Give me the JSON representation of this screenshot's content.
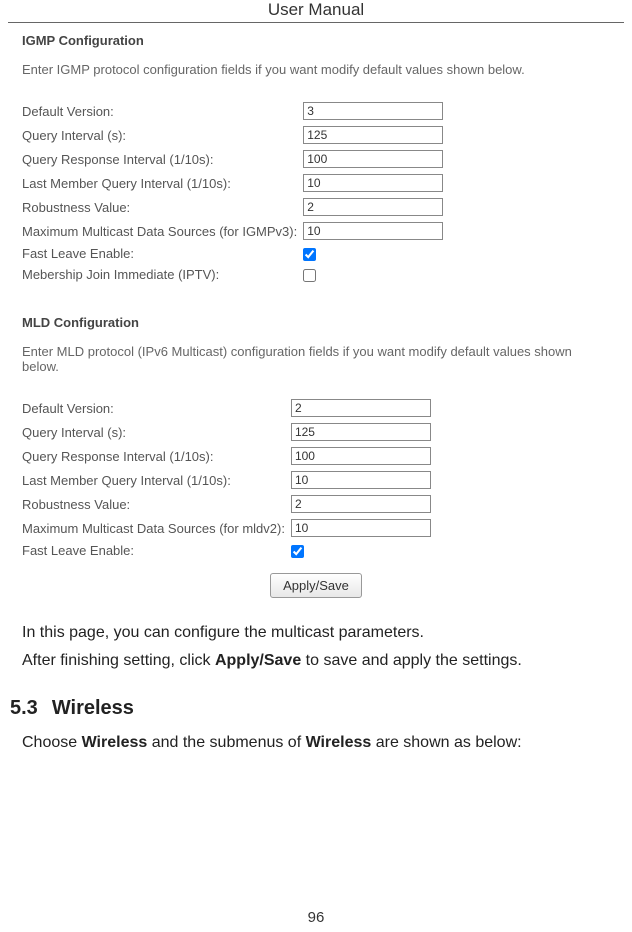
{
  "header": "User Manual",
  "igmp": {
    "title": "IGMP Configuration",
    "desc": "Enter IGMP protocol configuration fields if you want modify default values shown below.",
    "fields": {
      "default_version": {
        "label": "Default Version:",
        "value": "3"
      },
      "query_interval": {
        "label": "Query Interval (s):",
        "value": "125"
      },
      "query_response_interval": {
        "label": "Query Response Interval (1/10s):",
        "value": "100"
      },
      "last_member_query": {
        "label": "Last Member Query Interval (1/10s):",
        "value": "10"
      },
      "robustness": {
        "label": "Robustness Value:",
        "value": "2"
      },
      "max_multicast": {
        "label": "Maximum Multicast Data Sources (for IGMPv3):",
        "value": "10"
      },
      "fast_leave": {
        "label": "Fast Leave Enable:",
        "checked": true
      },
      "membership_join": {
        "label": "Mebership Join Immediate (IPTV):",
        "checked": false
      }
    }
  },
  "mld": {
    "title": "MLD Configuration",
    "desc": "Enter MLD protocol (IPv6 Multicast) configuration fields if you want modify default values shown below.",
    "fields": {
      "default_version": {
        "label": "Default Version:",
        "value": "2"
      },
      "query_interval": {
        "label": "Query Interval (s):",
        "value": "125"
      },
      "query_response_interval": {
        "label": "Query Response Interval (1/10s):",
        "value": "100"
      },
      "last_member_query": {
        "label": "Last Member Query Interval (1/10s):",
        "value": "10"
      },
      "robustness": {
        "label": "Robustness Value:",
        "value": "2"
      },
      "max_multicast": {
        "label": "Maximum Multicast Data Sources (for mldv2):",
        "value": "10"
      },
      "fast_leave": {
        "label": "Fast Leave Enable:",
        "checked": true
      }
    }
  },
  "apply_button": "Apply/Save",
  "body": {
    "line1_a": "In this page, you can configure the multicast parameters.",
    "line2_a": "After finishing setting, click ",
    "line2_b": "Apply/Save",
    "line2_c": " to save and apply the settings."
  },
  "section": {
    "num": "5.3",
    "title": "Wireless",
    "text_a": "Choose ",
    "text_b": "Wireless",
    "text_c": " and the submenus of ",
    "text_d": "Wireless",
    "text_e": " are shown as below:"
  },
  "page_number": "96"
}
